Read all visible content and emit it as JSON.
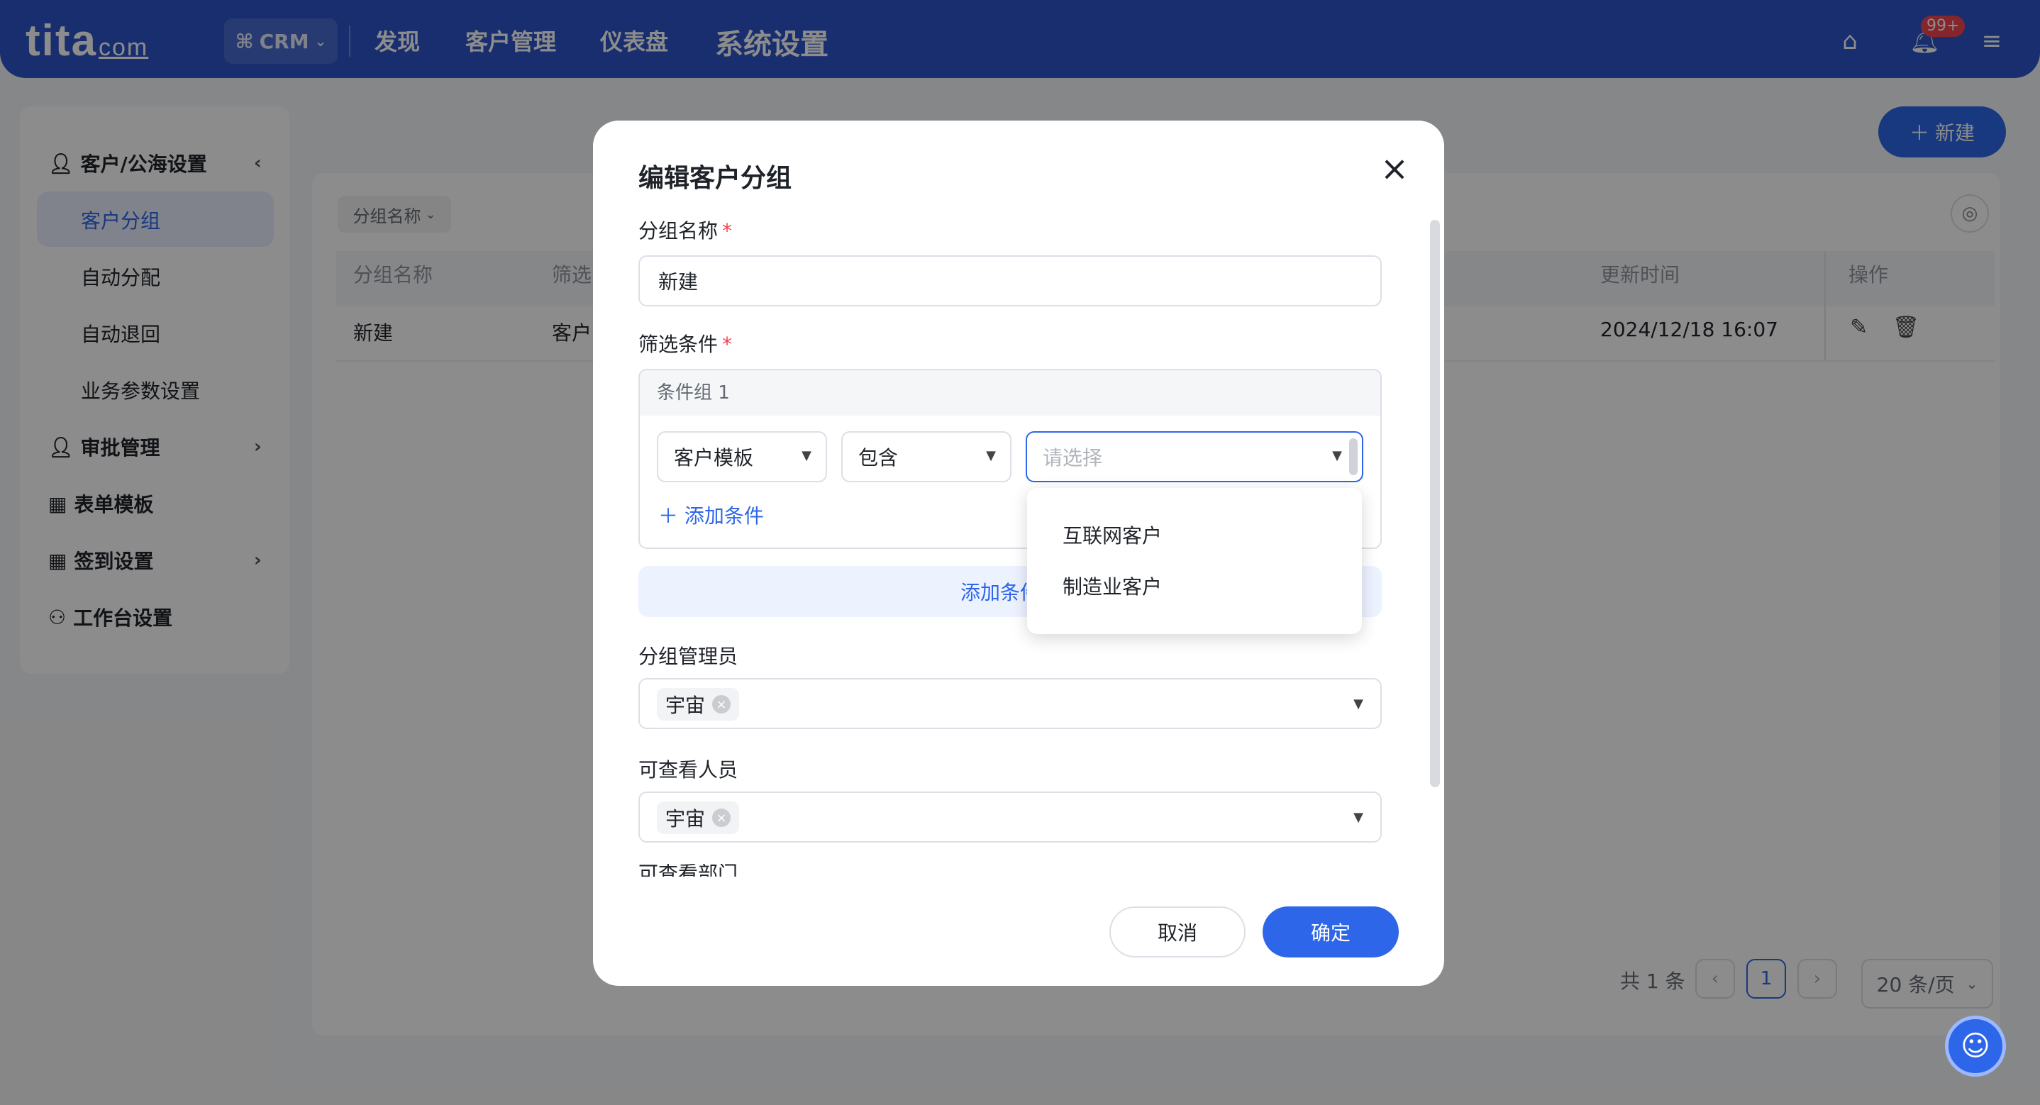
{
  "topbar": {
    "logo_main": "tita",
    "logo_suffix": "com",
    "app_switch": "CRM",
    "nav": [
      "发现",
      "客户管理",
      "仪表盘",
      "系统设置"
    ],
    "notification_badge": "99+"
  },
  "sidebar": {
    "groups": [
      {
        "label": "客户/公海设置",
        "icon": "user-icon"
      },
      {
        "label": "审批管理",
        "icon": "user-icon"
      },
      {
        "label": "表单模板",
        "icon": "grid-icon"
      },
      {
        "label": "签到设置",
        "icon": "grid-icon"
      },
      {
        "label": "工作台设置",
        "icon": "people-icon"
      }
    ],
    "sub_items": [
      "客户分组",
      "自动分配",
      "自动退回",
      "业务参数设置"
    ],
    "active_sub": "客户分组"
  },
  "main": {
    "new_button": "新建",
    "filter_chip": "分组名称",
    "columns": [
      "分组名称",
      "筛选",
      "更新时间",
      "操作"
    ],
    "rows": [
      {
        "name": "新建",
        "filter": "客户",
        "updated": "2024/12/18 16:07"
      }
    ],
    "pager": {
      "total_text": "共 1 条",
      "current_page": "1",
      "page_size": "20 条/页"
    }
  },
  "modal": {
    "title": "编辑客户分组",
    "group_name_label": "分组名称",
    "group_name_value": "新建",
    "filter_label": "筛选条件",
    "condition_group_title": "条件组 1",
    "field_select": "客户模板",
    "operator_select": "包含",
    "value_placeholder": "请选择",
    "add_condition": "添加条件",
    "add_condition_group": "添加条件组",
    "dropdown_options": [
      "互联网客户",
      "制造业客户"
    ],
    "manager_label": "分组管理员",
    "manager_tag": "宇宙",
    "viewer_label": "可查看人员",
    "viewer_tag": "宇宙",
    "dept_label": "可查看部门",
    "cancel": "取消",
    "confirm": "确定"
  },
  "colors": {
    "primary": "#2d66e8",
    "topbar": "#2d54c9",
    "required": "#f0454f"
  }
}
